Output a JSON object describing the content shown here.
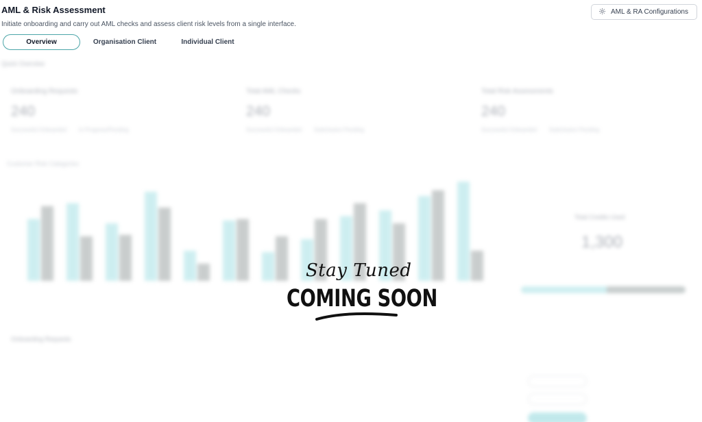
{
  "header": {
    "title": "AML & Risk Assessment",
    "subtitle": "Initiate onboarding and carry out AML checks and assess client risk levels from a single interface.",
    "config_button": "AML & RA Configurations"
  },
  "tabs": [
    {
      "label": "Overview",
      "active": true
    },
    {
      "label": "Organisation Client",
      "active": false
    },
    {
      "label": "Individual Client",
      "active": false
    }
  ],
  "overlay": {
    "stay_tuned": "Stay Tuned",
    "coming_soon": "COMING SOON"
  },
  "background": {
    "section_label": "Quick Overview",
    "stats": [
      {
        "title": "Onboarding Requests",
        "value": "240",
        "meta_a": "Successful Onboarded",
        "meta_b": "In Progress/Pending"
      },
      {
        "title": "Total AML Checks",
        "value": "240",
        "meta_a": "Successful Onboarded",
        "meta_b": "Submission Pending"
      },
      {
        "title": "Total Risk Assessments",
        "value": "240",
        "meta_a": "Successful Onboarded",
        "meta_b": "Submission Pending"
      }
    ],
    "chart_title": "Customer Risk Categories",
    "total_label": "Total Credits Used",
    "total_value": "1,300",
    "total_fraction": 0.52,
    "table_title": "Onboarding Requests",
    "colors": {
      "teal": "#a6e1e5",
      "grey": "#9ea5a5",
      "accent": "#4ba5a8"
    },
    "bars_a": [
      4.3,
      5.4,
      4.0,
      6.2,
      2.1,
      4.2,
      2.0,
      2.9,
      4.5,
      4.9,
      5.9,
      6.9
    ],
    "bars_b": [
      5.2,
      3.1,
      3.2,
      5.1,
      1.2,
      4.3,
      3.1,
      4.3,
      5.4,
      4.0,
      6.3,
      2.1
    ]
  }
}
